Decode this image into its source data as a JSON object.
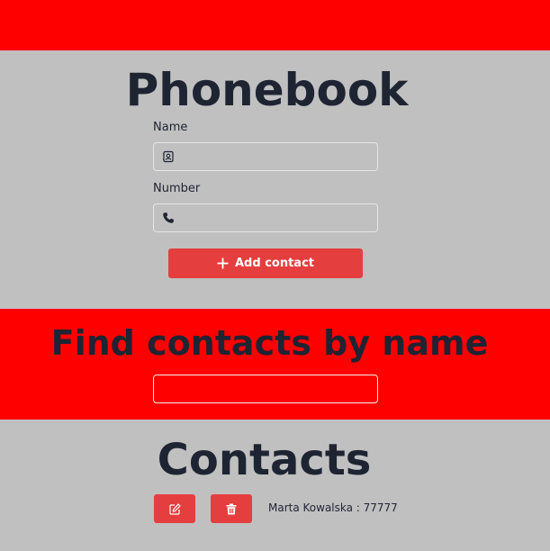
{
  "colors": {
    "accent_red": "#ff0000",
    "button_red": "#e53e3e",
    "background_gray": "#c0c0c0",
    "heading": "#1f2433"
  },
  "phonebook": {
    "title": "Phonebook",
    "name_label": "Name",
    "name_value": "",
    "name_icon": "contact-card-icon",
    "number_label": "Number",
    "number_value": "",
    "number_icon": "phone-icon",
    "add_button_label": "Add contact",
    "add_button_icon": "plus-icon"
  },
  "filter": {
    "title": "Find contacts by name",
    "value": ""
  },
  "contacts": {
    "title": "Contacts",
    "items": [
      {
        "text": "Marta Kowalska : 77777",
        "edit_icon": "edit-icon",
        "delete_icon": "trash-icon"
      }
    ]
  }
}
